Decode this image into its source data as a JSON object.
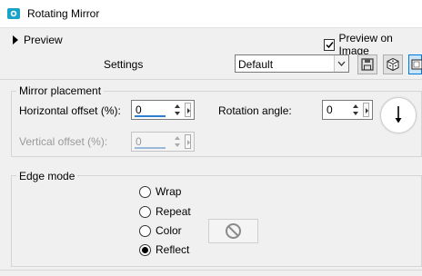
{
  "window": {
    "title": "Rotating Mirror",
    "icon": "app-icon"
  },
  "preview": {
    "toggle_label": "Preview",
    "on_image_label": "Preview on Image",
    "on_image_checked": true
  },
  "settings": {
    "label": "Settings",
    "preset_value": "Default"
  },
  "toolbar": {
    "icons": [
      "save-preset-icon",
      "randomize-icon",
      "reset-icon"
    ]
  },
  "mirror_placement": {
    "title": "Mirror placement",
    "horizontal_offset_label": "Horizontal offset (%):",
    "horizontal_offset_value": "0",
    "vertical_offset_label": "Vertical offset (%):",
    "vertical_offset_value": "0",
    "vertical_offset_enabled": false,
    "rotation_angle_label": "Rotation angle:",
    "rotation_angle_value": "0"
  },
  "edge_mode": {
    "title": "Edge mode",
    "options": [
      "Wrap",
      "Repeat",
      "Color",
      "Reflect"
    ],
    "selected": "Reflect",
    "color_swatch_icon": "no-color-icon"
  },
  "colors": {
    "accent": "#0078d7",
    "spin_bar": "#2d7dd2",
    "window_bg": "#f0f0f0"
  }
}
